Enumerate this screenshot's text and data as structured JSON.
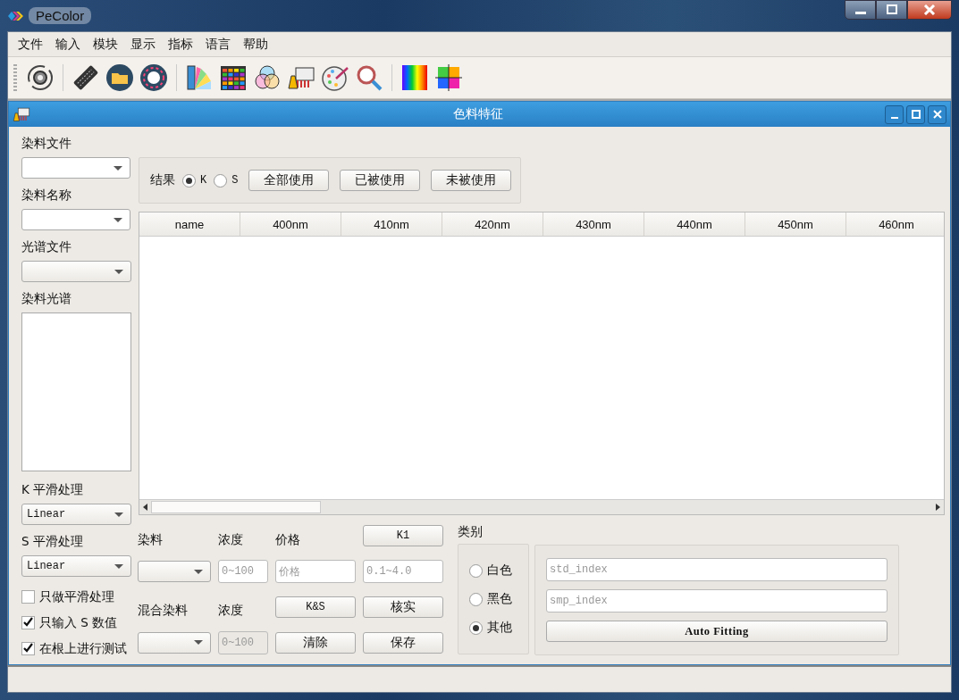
{
  "window": {
    "title": "PeColor"
  },
  "menu": [
    "文件",
    "输入",
    "模块",
    "显示",
    "指标",
    "语言",
    "帮助"
  ],
  "subwindow": {
    "title": "色料特征"
  },
  "left": {
    "dye_file": {
      "label": "染料文件"
    },
    "dye_name": {
      "label": "染料名称"
    },
    "spectrum_file": {
      "label": "光谱文件"
    },
    "dye_spectrum": {
      "label": "染料光谱"
    },
    "k_smoothing": {
      "label": "K 平滑处理",
      "value": "Linear"
    },
    "s_smoothing": {
      "label": "S 平滑处理",
      "value": "Linear"
    },
    "checkboxes": [
      {
        "label": "只做平滑处理",
        "checked": false
      },
      {
        "label": "只输入 S 数值",
        "checked": true
      },
      {
        "label": "在根上进行测试",
        "checked": true
      }
    ]
  },
  "result": {
    "label": "结果",
    "radios": [
      {
        "label": "K",
        "selected": true
      },
      {
        "label": "S",
        "selected": false
      }
    ],
    "buttons": [
      "全部使用",
      "已被使用",
      "未被使用"
    ]
  },
  "table": {
    "columns": [
      "name",
      "400nm",
      "410nm",
      "420nm",
      "430nm",
      "440nm",
      "450nm",
      "460nm"
    ]
  },
  "form": {
    "dye_label": "染料",
    "conc_label": "浓度",
    "price_label": "价格",
    "k1_button": "K1",
    "conc_placeholder": "0~100",
    "price_placeholder": "价格",
    "range_placeholder": "0.1~4.0",
    "mix_label": "混合染料",
    "mix_conc_label": "浓度",
    "ks_button": "K&S",
    "verify_button": "核实",
    "mix_conc_placeholder": "0~100",
    "mix_conc_disabled": true,
    "clear_button": "清除",
    "save_button": "保存"
  },
  "category": {
    "label": "类别",
    "radios": [
      {
        "label": "白色",
        "selected": false
      },
      {
        "label": "黑色",
        "selected": false
      },
      {
        "label": "其他",
        "selected": true
      }
    ]
  },
  "fitting": {
    "std_placeholder": "std_index",
    "smp_placeholder": "smp_index",
    "button": "Auto Fitting"
  }
}
